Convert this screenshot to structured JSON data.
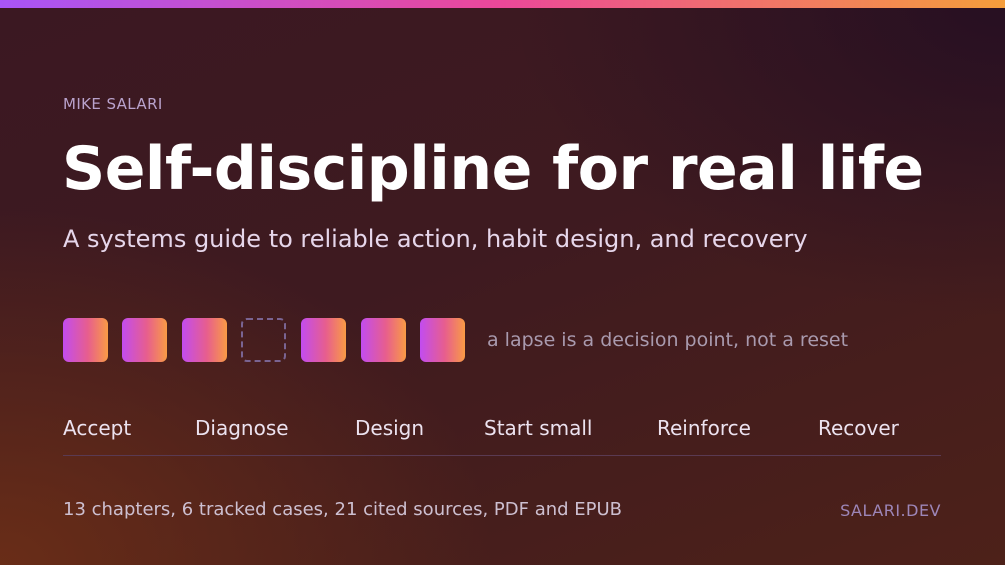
{
  "author": "MIKE SALARI",
  "title": "Self-discipline for real life",
  "subtitle": "A systems guide to reliable action, habit design, and recovery",
  "streak": {
    "days": [
      "done",
      "done",
      "done",
      "missed",
      "done",
      "done",
      "done"
    ],
    "note": "a lapse is a decision point, not a reset"
  },
  "steps": [
    "Accept",
    "Diagnose",
    "Design",
    "Start small",
    "Reinforce",
    "Recover"
  ],
  "details": "13 chapters, 6 tracked cases, 21 cited sources, PDF and EPUB",
  "site": "SALARI.DEV",
  "colors": {
    "accent_start": "#a855f7",
    "accent_mid": "#ec4899",
    "accent_end": "#f59e3b",
    "title": "#ffffff",
    "muted": "#a99aae"
  }
}
